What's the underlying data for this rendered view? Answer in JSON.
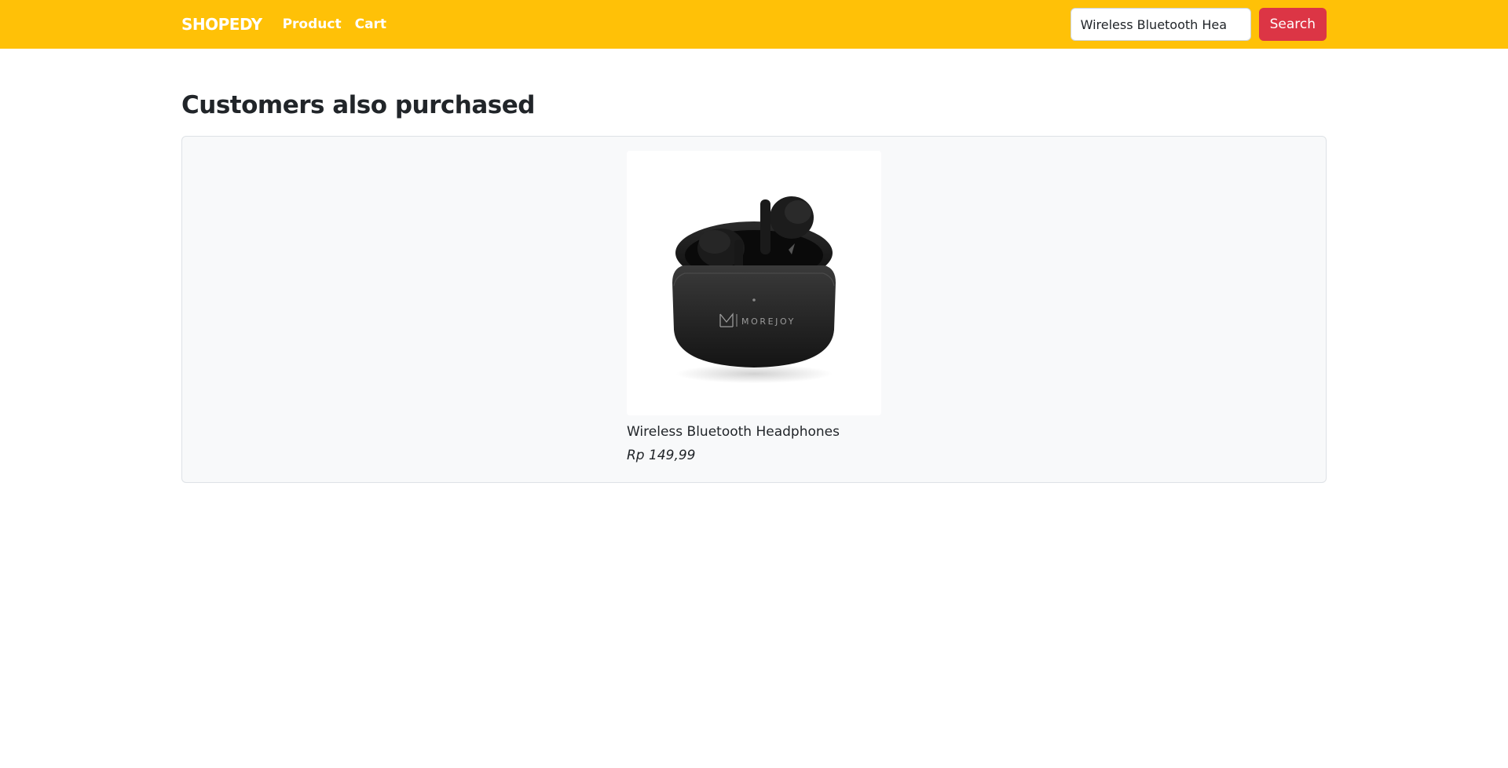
{
  "navbar": {
    "brand": "SHOPEDY",
    "links": [
      "Product",
      "Cart"
    ],
    "search": {
      "value": "Wireless Bluetooth Hea",
      "button_label": "Search"
    },
    "colors": {
      "background": "#ffc107",
      "search_button": "#dc3545"
    }
  },
  "main": {
    "section_title": "Customers also purchased",
    "products": [
      {
        "name": "Wireless Bluetooth Headphones",
        "price": "Rp 149,99",
        "image_icon": "earbuds-case-image",
        "image_logo_text": "MOREJOY"
      }
    ]
  }
}
